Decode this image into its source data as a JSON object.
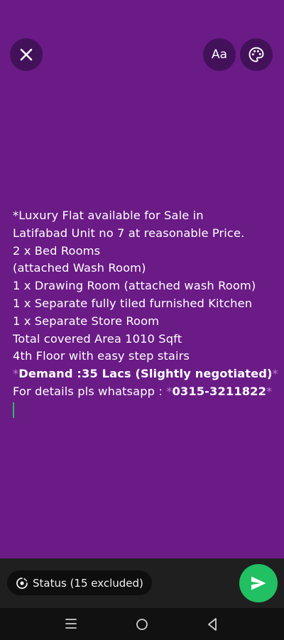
{
  "header": {
    "font_button_label": "Aa"
  },
  "message": {
    "line1_marker": "*",
    "line1_text": "Luxury Flat available for Sale in",
    "line2": "Latifabad Unit no 7 at reasonable Price.",
    "line3": "2 x Bed Rooms",
    "line4": "(attached Wash Room)",
    "line5": "1 x Drawing Room (attached wash Room)",
    "line6": "1 x Separate fully tiled furnished Kitchen",
    "line7": "1 x Separate Store Room",
    "line8": "Total covered Area 1010 Sqft",
    "line9": "4th Floor with easy step stairs",
    "line10_marker_left": "*",
    "line10_bold": "Demand :35 Lacs (Slightly negotiated)",
    "line10_marker_right": "*",
    "line11_text": "For details pls whatsapp : ",
    "line11_marker_left": "*",
    "line11_bold": "0315-3211822",
    "line11_marker_right": "*"
  },
  "bottom": {
    "status_label": "Status (15 excluded)"
  },
  "colors": {
    "canvas": "#6a1b86",
    "button_bg": "#43115a",
    "accent_green": "#21c063"
  },
  "icons": {
    "close": "close-icon",
    "palette": "palette-icon",
    "status": "status-icon",
    "send": "send-icon"
  }
}
